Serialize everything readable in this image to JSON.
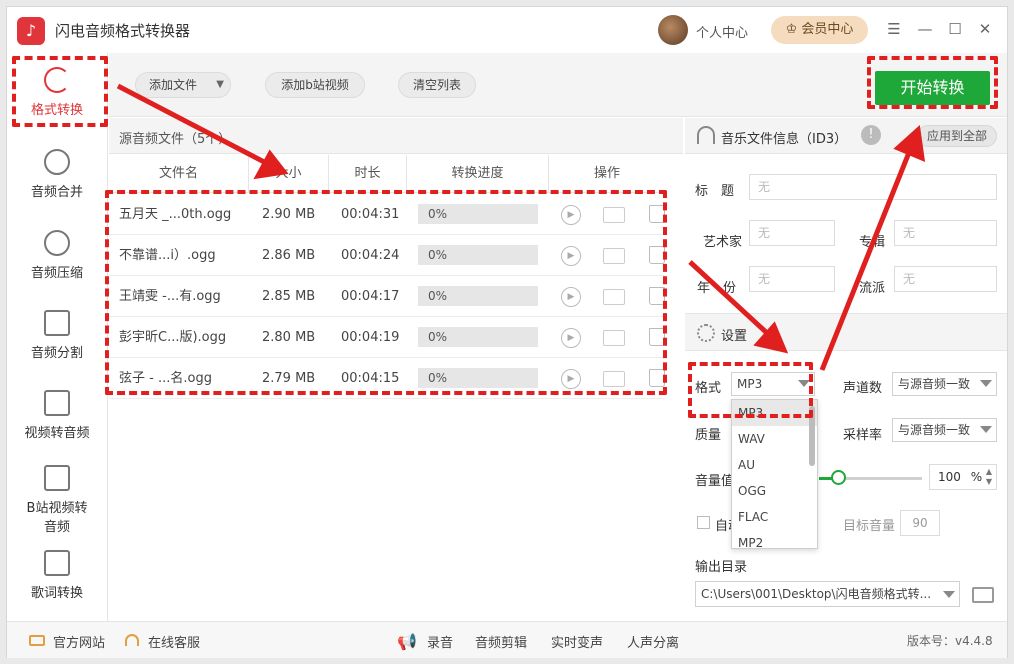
{
  "app": {
    "logo": "♪",
    "title": "闪电音频格式转换器"
  },
  "header": {
    "personal_center": "个人中心",
    "vip_center": "会员中心"
  },
  "window_controls": {
    "menu": "☰",
    "minimize": "—",
    "maximize": "☐",
    "close": "✕"
  },
  "sidebar": {
    "items": [
      {
        "label": "格式转换",
        "icon": "refresh-icon"
      },
      {
        "label": "音频合并",
        "icon": "merge-icon"
      },
      {
        "label": "音频压缩",
        "icon": "compress-icon"
      },
      {
        "label": "音频分割",
        "icon": "split-icon"
      },
      {
        "label": "视频转音频",
        "icon": "video-icon"
      },
      {
        "label": "B站视频转",
        "label2": "音频",
        "icon": "bilibili-icon"
      },
      {
        "label": "歌词转换",
        "icon": "lyrics-icon"
      }
    ]
  },
  "toolbar": {
    "add_file": "添加文件",
    "add_bilibili": "添加b站视频",
    "clear_list": "清空列表",
    "start": "开始转换"
  },
  "file_list": {
    "title": "源音频文件（5个）",
    "columns": [
      "文件名",
      "大小",
      "时长",
      "转换进度",
      "操作"
    ],
    "rows": [
      {
        "name": "五月天 _...0th.ogg",
        "size": "2.90 MB",
        "duration": "00:04:31",
        "progress": "0%"
      },
      {
        "name": "不靠谱...i）.ogg",
        "size": "2.86 MB",
        "duration": "00:04:24",
        "progress": "0%"
      },
      {
        "name": "王靖雯 -...有.ogg",
        "size": "2.85 MB",
        "duration": "00:04:17",
        "progress": "0%"
      },
      {
        "name": "彭宇昕C...版).ogg",
        "size": "2.80 MB",
        "duration": "00:04:19",
        "progress": "0%"
      },
      {
        "name": "弦子 - ...名.ogg",
        "size": "2.79 MB",
        "duration": "00:04:15",
        "progress": "0%"
      }
    ]
  },
  "id3": {
    "title": "音乐文件信息（ID3）",
    "apply_all": "应用到全部",
    "title_label": "标　题",
    "artist_label": "艺术家",
    "album_label": "专辑",
    "year_label": "年　份",
    "genre_label": "流派",
    "placeholder": "无"
  },
  "settings": {
    "title": "设置",
    "format_label": "格式",
    "format_value": "MP3",
    "format_options": [
      "MP3",
      "WAV",
      "AU",
      "OGG",
      "FLAC",
      "MP2"
    ],
    "channels_label": "声道数",
    "channels_value": "与源音频一致",
    "quality_label": "质量",
    "samplerate_label": "采样率",
    "samplerate_value": "与源音频一致",
    "volume_label": "音量值",
    "volume_value": "100",
    "volume_unit": "%",
    "volume_level": 0.1,
    "auto_label": "自动",
    "target_volume_label": "目标音量",
    "target_volume_value": "90",
    "output_label": "输出目录",
    "output_path": "C:\\Users\\001\\Desktop\\闪电音频格式转..."
  },
  "bottombar": {
    "website": "官方网站",
    "support": "在线客服",
    "record": "录音",
    "edit": "音频剪辑",
    "realtime": "实时变声",
    "vocal": "人声分离",
    "version": "版本号：v4.4.8"
  },
  "colors": {
    "accent_red": "#e0353a",
    "green": "#1ea83a",
    "annotation": "#e01f1f"
  }
}
